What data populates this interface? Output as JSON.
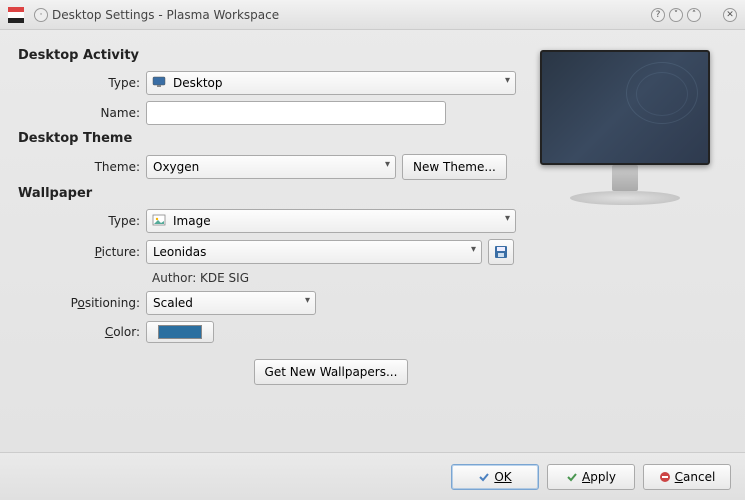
{
  "window": {
    "title": "Desktop Settings - Plasma Workspace"
  },
  "sections": {
    "activity": {
      "heading": "Desktop Activity",
      "type_label": "Type:",
      "type_value": "Desktop",
      "name_label": "Name:",
      "name_value": ""
    },
    "theme": {
      "heading": "Desktop Theme",
      "theme_label": "Theme:",
      "theme_value": "Oxygen",
      "new_theme_button": "New Theme..."
    },
    "wallpaper": {
      "heading": "Wallpaper",
      "type_label": "Type:",
      "type_value": "Image",
      "picture_label": "Picture:",
      "picture_value": "Leonidas",
      "author_label": "Author: KDE SIG",
      "positioning_label": "Positioning:",
      "positioning_value": "Scaled",
      "color_label": "Color:",
      "color_value": "#2a6fa0",
      "get_new_button": "Get New Wallpapers..."
    }
  },
  "footer": {
    "ok": "OK",
    "apply": "Apply",
    "cancel": "Cancel"
  }
}
